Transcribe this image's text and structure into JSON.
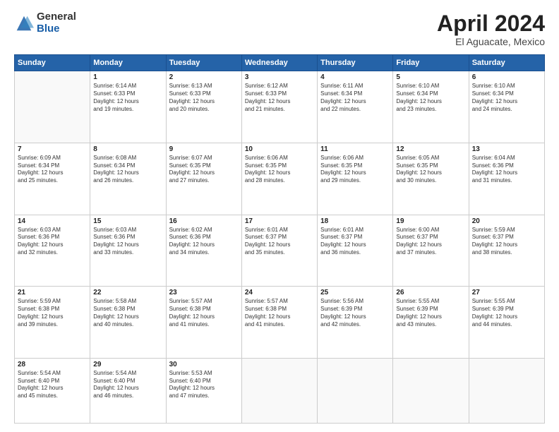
{
  "logo": {
    "general": "General",
    "blue": "Blue"
  },
  "title": "April 2024",
  "subtitle": "El Aguacate, Mexico",
  "days_header": [
    "Sunday",
    "Monday",
    "Tuesday",
    "Wednesday",
    "Thursday",
    "Friday",
    "Saturday"
  ],
  "weeks": [
    [
      {
        "num": "",
        "text": ""
      },
      {
        "num": "1",
        "text": "Sunrise: 6:14 AM\nSunset: 6:33 PM\nDaylight: 12 hours\nand 19 minutes."
      },
      {
        "num": "2",
        "text": "Sunrise: 6:13 AM\nSunset: 6:33 PM\nDaylight: 12 hours\nand 20 minutes."
      },
      {
        "num": "3",
        "text": "Sunrise: 6:12 AM\nSunset: 6:33 PM\nDaylight: 12 hours\nand 21 minutes."
      },
      {
        "num": "4",
        "text": "Sunrise: 6:11 AM\nSunset: 6:34 PM\nDaylight: 12 hours\nand 22 minutes."
      },
      {
        "num": "5",
        "text": "Sunrise: 6:10 AM\nSunset: 6:34 PM\nDaylight: 12 hours\nand 23 minutes."
      },
      {
        "num": "6",
        "text": "Sunrise: 6:10 AM\nSunset: 6:34 PM\nDaylight: 12 hours\nand 24 minutes."
      }
    ],
    [
      {
        "num": "7",
        "text": "Sunrise: 6:09 AM\nSunset: 6:34 PM\nDaylight: 12 hours\nand 25 minutes."
      },
      {
        "num": "8",
        "text": "Sunrise: 6:08 AM\nSunset: 6:34 PM\nDaylight: 12 hours\nand 26 minutes."
      },
      {
        "num": "9",
        "text": "Sunrise: 6:07 AM\nSunset: 6:35 PM\nDaylight: 12 hours\nand 27 minutes."
      },
      {
        "num": "10",
        "text": "Sunrise: 6:06 AM\nSunset: 6:35 PM\nDaylight: 12 hours\nand 28 minutes."
      },
      {
        "num": "11",
        "text": "Sunrise: 6:06 AM\nSunset: 6:35 PM\nDaylight: 12 hours\nand 29 minutes."
      },
      {
        "num": "12",
        "text": "Sunrise: 6:05 AM\nSunset: 6:35 PM\nDaylight: 12 hours\nand 30 minutes."
      },
      {
        "num": "13",
        "text": "Sunrise: 6:04 AM\nSunset: 6:36 PM\nDaylight: 12 hours\nand 31 minutes."
      }
    ],
    [
      {
        "num": "14",
        "text": "Sunrise: 6:03 AM\nSunset: 6:36 PM\nDaylight: 12 hours\nand 32 minutes."
      },
      {
        "num": "15",
        "text": "Sunrise: 6:03 AM\nSunset: 6:36 PM\nDaylight: 12 hours\nand 33 minutes."
      },
      {
        "num": "16",
        "text": "Sunrise: 6:02 AM\nSunset: 6:36 PM\nDaylight: 12 hours\nand 34 minutes."
      },
      {
        "num": "17",
        "text": "Sunrise: 6:01 AM\nSunset: 6:37 PM\nDaylight: 12 hours\nand 35 minutes."
      },
      {
        "num": "18",
        "text": "Sunrise: 6:01 AM\nSunset: 6:37 PM\nDaylight: 12 hours\nand 36 minutes."
      },
      {
        "num": "19",
        "text": "Sunrise: 6:00 AM\nSunset: 6:37 PM\nDaylight: 12 hours\nand 37 minutes."
      },
      {
        "num": "20",
        "text": "Sunrise: 5:59 AM\nSunset: 6:37 PM\nDaylight: 12 hours\nand 38 minutes."
      }
    ],
    [
      {
        "num": "21",
        "text": "Sunrise: 5:59 AM\nSunset: 6:38 PM\nDaylight: 12 hours\nand 39 minutes."
      },
      {
        "num": "22",
        "text": "Sunrise: 5:58 AM\nSunset: 6:38 PM\nDaylight: 12 hours\nand 40 minutes."
      },
      {
        "num": "23",
        "text": "Sunrise: 5:57 AM\nSunset: 6:38 PM\nDaylight: 12 hours\nand 41 minutes."
      },
      {
        "num": "24",
        "text": "Sunrise: 5:57 AM\nSunset: 6:38 PM\nDaylight: 12 hours\nand 41 minutes."
      },
      {
        "num": "25",
        "text": "Sunrise: 5:56 AM\nSunset: 6:39 PM\nDaylight: 12 hours\nand 42 minutes."
      },
      {
        "num": "26",
        "text": "Sunrise: 5:55 AM\nSunset: 6:39 PM\nDaylight: 12 hours\nand 43 minutes."
      },
      {
        "num": "27",
        "text": "Sunrise: 5:55 AM\nSunset: 6:39 PM\nDaylight: 12 hours\nand 44 minutes."
      }
    ],
    [
      {
        "num": "28",
        "text": "Sunrise: 5:54 AM\nSunset: 6:40 PM\nDaylight: 12 hours\nand 45 minutes."
      },
      {
        "num": "29",
        "text": "Sunrise: 5:54 AM\nSunset: 6:40 PM\nDaylight: 12 hours\nand 46 minutes."
      },
      {
        "num": "30",
        "text": "Sunrise: 5:53 AM\nSunset: 6:40 PM\nDaylight: 12 hours\nand 47 minutes."
      },
      {
        "num": "",
        "text": ""
      },
      {
        "num": "",
        "text": ""
      },
      {
        "num": "",
        "text": ""
      },
      {
        "num": "",
        "text": ""
      }
    ]
  ]
}
